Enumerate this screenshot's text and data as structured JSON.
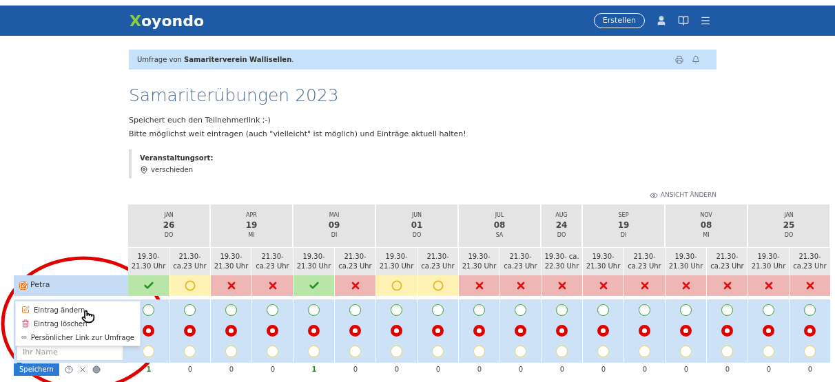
{
  "header": {
    "logo_first": "X",
    "logo_rest": "oyondo",
    "create_button": "Erstellen"
  },
  "notice": "Umfrage von **Samariterverein Wallisellen**.",
  "title": "Samariterübungen 2023",
  "description": [
    "Speichert euch den Teilnehmerlink ;-)",
    "Bitte möglichst weit eintragen (auch \"vielleicht\" ist möglich) und Einträge aktuell halten!"
  ],
  "location": {
    "label": "Veranstaltungsort:",
    "value": "verschieden"
  },
  "view_toggle": "ANSICHT ÄNDERN",
  "dates": [
    {
      "month": "JAN",
      "day": "26",
      "weekday": "DO",
      "slots": [
        [
          "19.30-",
          "21.30 Uhr"
        ],
        [
          "21.30-",
          "ca.23 Uhr"
        ]
      ]
    },
    {
      "month": "APR",
      "day": "19",
      "weekday": "MI",
      "slots": [
        [
          "19.30-",
          "21.30 Uhr"
        ],
        [
          "21.30-",
          "ca.23 Uhr"
        ]
      ]
    },
    {
      "month": "MAI",
      "day": "09",
      "weekday": "DI",
      "slots": [
        [
          "19.30-",
          "21.30 Uhr"
        ],
        [
          "21.30-",
          "ca.23 Uhr"
        ]
      ]
    },
    {
      "month": "JUN",
      "day": "01",
      "weekday": "DO",
      "slots": [
        [
          "19.30-",
          "21.30 Uhr"
        ],
        [
          "21.30-",
          "ca.23 Uhr"
        ]
      ]
    },
    {
      "month": "JUL",
      "day": "08",
      "weekday": "SA",
      "slots": [
        [
          "19.30-",
          "21.30 Uhr"
        ],
        [
          "21.30-",
          "ca.23 Uhr"
        ]
      ]
    },
    {
      "month": "AUG",
      "day": "24",
      "weekday": "DO",
      "slots": [
        [
          "19.30- ca.",
          "22.30 Uhr"
        ]
      ]
    },
    {
      "month": "SEP",
      "day": "19",
      "weekday": "DI",
      "slots": [
        [
          "19.30-",
          "21.30 Uhr"
        ],
        [
          "21.30-",
          "ca.23 Uhr"
        ]
      ]
    },
    {
      "month": "NOV",
      "day": "08",
      "weekday": "MI",
      "slots": [
        [
          "19.30-",
          "21.30 Uhr"
        ],
        [
          "21.30-",
          "ca.23 Uhr"
        ]
      ]
    },
    {
      "month": "JAN",
      "day": "25",
      "weekday": "DO",
      "slots": [
        [
          "19.30-",
          "21.30 Uhr"
        ],
        [
          "21.30-",
          "ca.23 Uhr"
        ]
      ]
    }
  ],
  "participants": [
    {
      "name": "Petra",
      "answers": [
        {
          "kind": "yes"
        },
        {
          "kind": "maybe"
        },
        {
          "kind": "no"
        },
        {
          "kind": "no"
        },
        {
          "kind": "yes"
        },
        {
          "kind": "no"
        },
        {
          "kind": "maybe"
        },
        {
          "kind": "maybe"
        },
        {
          "kind": "no"
        },
        {
          "kind": "no"
        },
        {
          "kind": "no"
        },
        {
          "kind": "no"
        },
        {
          "kind": "no"
        },
        {
          "kind": "no"
        },
        {
          "kind": "no"
        },
        {
          "kind": "no"
        },
        {
          "kind": "no"
        }
      ]
    }
  ],
  "new_entry": {
    "placeholder": "Ihr Name",
    "choices": [
      [
        {
          "kind": "yes",
          "selected": false
        },
        {
          "kind": "no",
          "selected": true
        },
        {
          "kind": "maybe",
          "selected": false
        }
      ],
      [
        {
          "kind": "yes",
          "selected": false
        },
        {
          "kind": "no",
          "selected": true
        },
        {
          "kind": "maybe",
          "selected": false
        }
      ],
      [
        {
          "kind": "yes",
          "selected": false
        },
        {
          "kind": "no",
          "selected": true
        },
        {
          "kind": "maybe",
          "selected": false
        }
      ],
      [
        {
          "kind": "yes",
          "selected": false
        },
        {
          "kind": "no",
          "selected": true
        },
        {
          "kind": "maybe",
          "selected": false
        }
      ],
      [
        {
          "kind": "yes",
          "selected": false
        },
        {
          "kind": "no",
          "selected": true
        },
        {
          "kind": "maybe",
          "selected": false
        }
      ],
      [
        {
          "kind": "yes",
          "selected": false
        },
        {
          "kind": "no",
          "selected": true
        },
        {
          "kind": "maybe",
          "selected": false
        }
      ],
      [
        {
          "kind": "yes",
          "selected": false
        },
        {
          "kind": "no",
          "selected": true
        },
        {
          "kind": "maybe",
          "selected": false
        }
      ],
      [
        {
          "kind": "yes",
          "selected": false
        },
        {
          "kind": "no",
          "selected": true
        },
        {
          "kind": "maybe",
          "selected": false
        }
      ],
      [
        {
          "kind": "yes",
          "selected": false
        },
        {
          "kind": "no",
          "selected": true
        },
        {
          "kind": "maybe",
          "selected": false
        }
      ],
      [
        {
          "kind": "yes",
          "selected": false
        },
        {
          "kind": "no",
          "selected": true
        },
        {
          "kind": "maybe",
          "selected": false
        }
      ],
      [
        {
          "kind": "yes",
          "selected": false
        },
        {
          "kind": "no",
          "selected": true
        },
        {
          "kind": "maybe",
          "selected": false
        }
      ],
      [
        {
          "kind": "yes",
          "selected": false
        },
        {
          "kind": "no",
          "selected": true
        },
        {
          "kind": "maybe",
          "selected": false
        }
      ],
      [
        {
          "kind": "yes",
          "selected": false
        },
        {
          "kind": "no",
          "selected": true
        },
        {
          "kind": "maybe",
          "selected": false
        }
      ],
      [
        {
          "kind": "yes",
          "selected": false
        },
        {
          "kind": "no",
          "selected": true
        },
        {
          "kind": "maybe",
          "selected": false
        }
      ],
      [
        {
          "kind": "yes",
          "selected": false
        },
        {
          "kind": "no",
          "selected": true
        },
        {
          "kind": "maybe",
          "selected": false
        }
      ],
      [
        {
          "kind": "yes",
          "selected": false
        },
        {
          "kind": "no",
          "selected": true
        },
        {
          "kind": "maybe",
          "selected": false
        }
      ],
      [
        {
          "kind": "yes",
          "selected": false
        },
        {
          "kind": "no",
          "selected": true
        },
        {
          "kind": "maybe",
          "selected": false
        }
      ]
    ]
  },
  "totals": [
    {
      "value": "1",
      "top": true
    },
    {
      "value": "0",
      "top": false
    },
    {
      "value": "0",
      "top": false
    },
    {
      "value": "0",
      "top": false
    },
    {
      "value": "1",
      "top": true
    },
    {
      "value": "0",
      "top": false
    },
    {
      "value": "0",
      "top": false
    },
    {
      "value": "0",
      "top": false
    },
    {
      "value": "0",
      "top": false
    },
    {
      "value": "0",
      "top": false
    },
    {
      "value": "0",
      "top": false
    },
    {
      "value": "0",
      "top": false
    },
    {
      "value": "0",
      "top": false
    },
    {
      "value": "0",
      "top": false
    },
    {
      "value": "0",
      "top": false
    },
    {
      "value": "0",
      "top": false
    },
    {
      "value": "0",
      "top": false
    }
  ],
  "save_button": "Speichern",
  "context_menu": [
    {
      "kind": "edit",
      "label": "Eintrag ändern"
    },
    {
      "kind": "delete",
      "label": "Eintrag löschen"
    },
    {
      "kind": "link",
      "label": "Persönlicher Link zur Umfrage"
    }
  ]
}
